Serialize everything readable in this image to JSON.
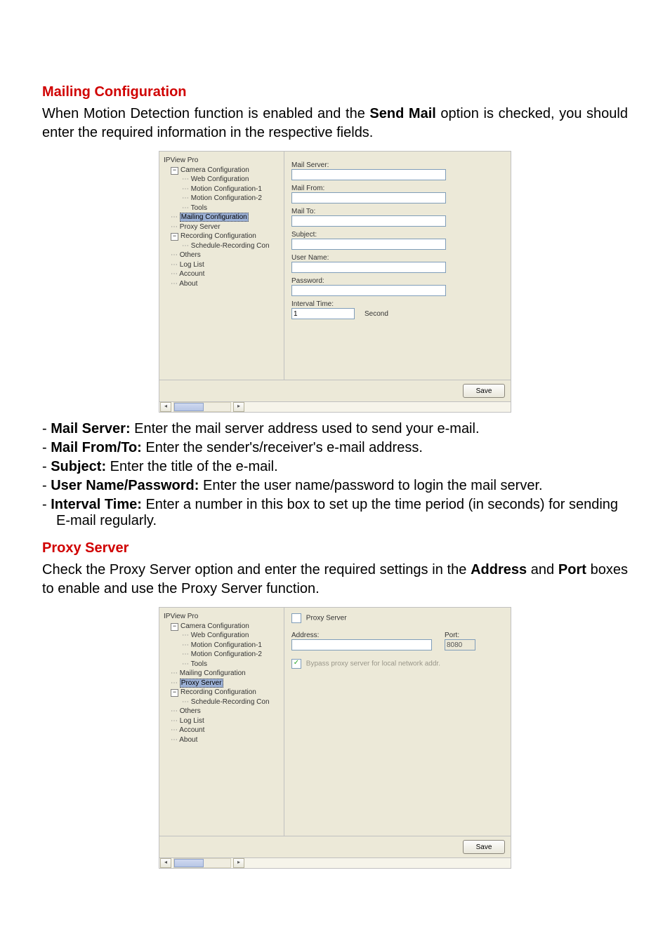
{
  "intro": {
    "heading_red": "Mailing Configuration",
    "para": "When Motion Detection function is enabled and the ",
    "bold": "Send Mail",
    "para2": " option is checked, you should enter the required information in the respective fields."
  },
  "tree": {
    "root": "IPView Pro",
    "camera_config": "Camera Configuration",
    "web_config": "Web Configuration",
    "motion1": "Motion Configuration-1",
    "motion2": "Motion Configuration-2",
    "tools": "Tools",
    "mailing": "Mailing Configuration",
    "proxy": "Proxy Server",
    "recording": "Recording Configuration",
    "sched": "Schedule-Recording Con",
    "others": "Others",
    "loglist": "Log List",
    "account": "Account",
    "about": "About"
  },
  "mailform": {
    "mail_server": "Mail Server:",
    "mail_from": "Mail From:",
    "mail_to": "Mail To:",
    "subject": "Subject:",
    "user_name": "User Name:",
    "password": "Password:",
    "interval": "Interval Time:",
    "interval_val": "1",
    "second": "Second",
    "save": "Save"
  },
  "defs": {
    "mail_server_t": "Mail Server:",
    "mail_server_d": " Enter the mail server address used to send your e-mail.",
    "mail_from_t": "Mail From/To:",
    "mail_from_d": " Enter the sender's/receiver's e-mail address.",
    "subject_t": "Subject:",
    "subject_d": " Enter the title of the e-mail.",
    "user_t": "User Name/Password:",
    "user_d": " Enter the user name/password to login the mail server.",
    "interval_t": "Interval Time:",
    "interval_d": " Enter a number in this box to set up the time period (in seconds) for sending E-mail regularly."
  },
  "proxy_section": {
    "heading_red": "Proxy Server",
    "para1": "Check the Proxy Server option and enter the required settings in the ",
    "bold1": "Address",
    "mid": " and ",
    "bold2": "Port",
    "para2": " boxes to enable and use the Proxy Server function."
  },
  "proxyform": {
    "proxy_label": "Proxy Server",
    "address": "Address:",
    "port": "Port:",
    "port_val": "8080",
    "bypass": "Bypass proxy server for local network addr.",
    "save": "Save"
  }
}
